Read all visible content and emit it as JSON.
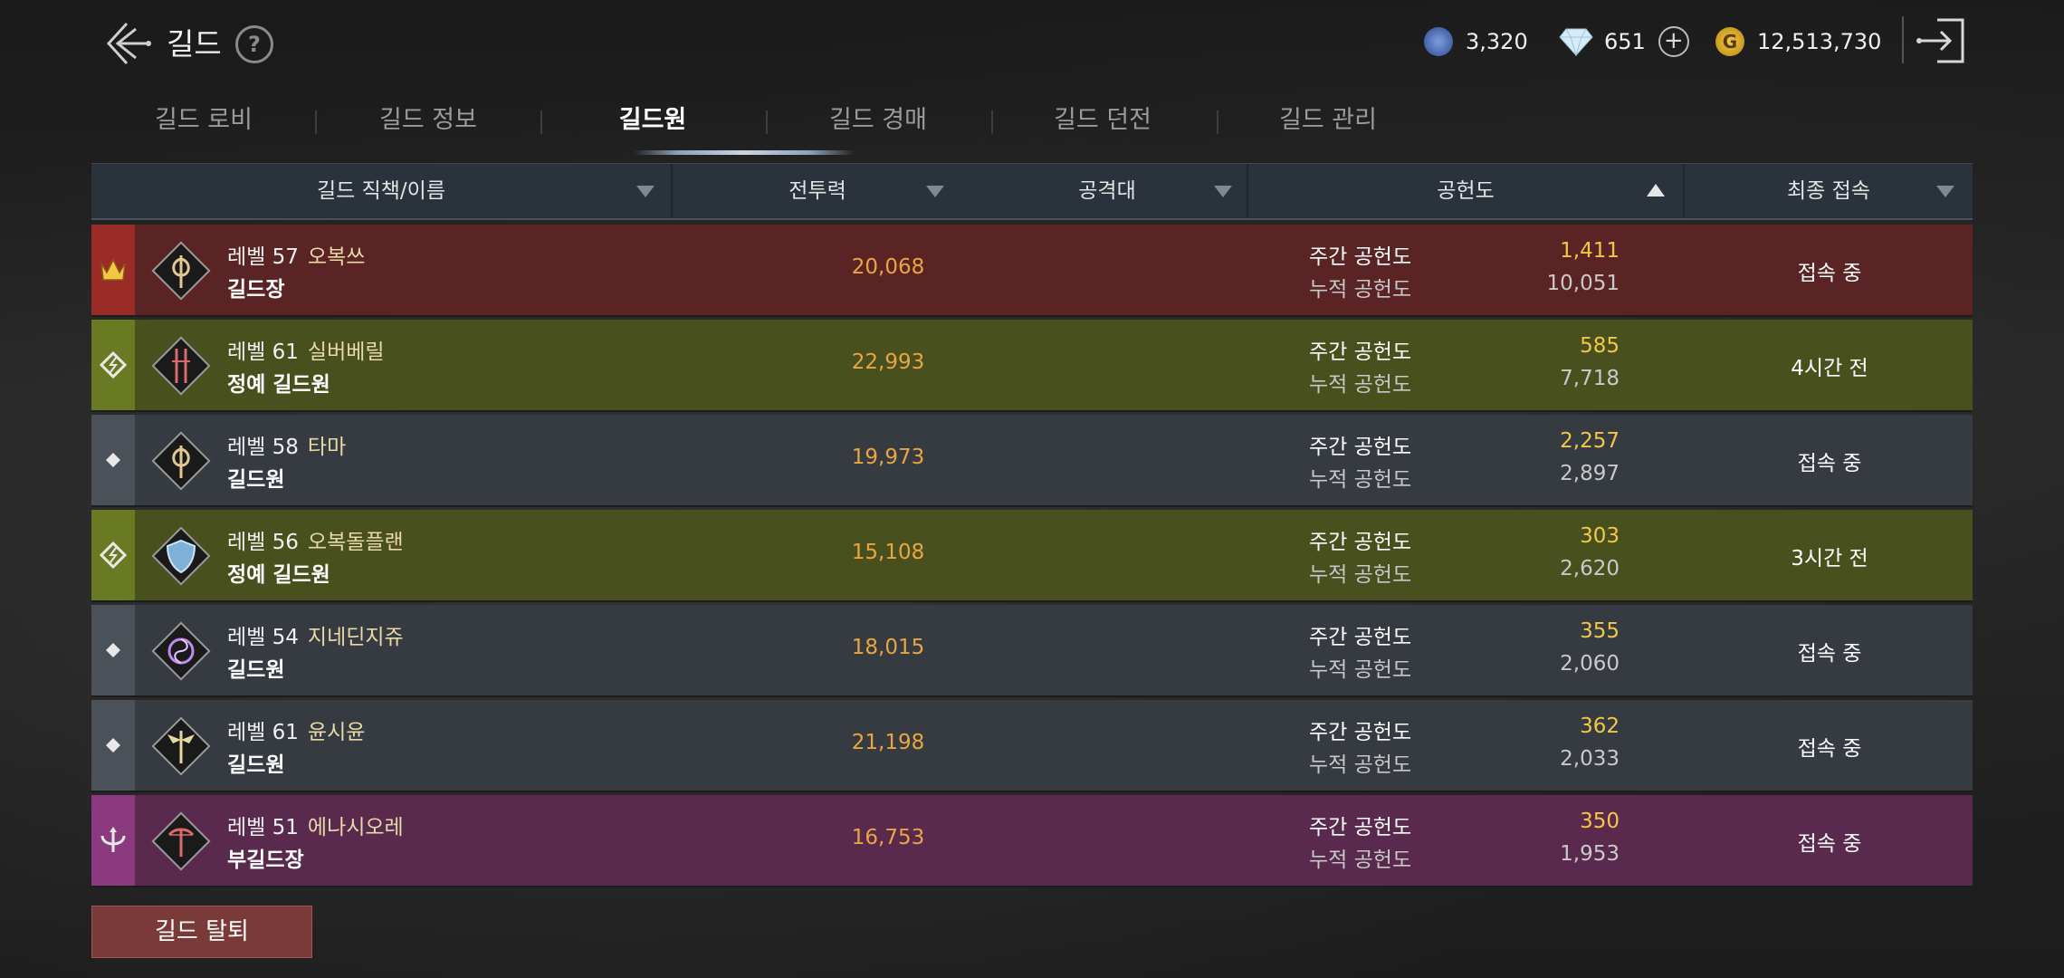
{
  "header": {
    "title": "길드",
    "help": "?",
    "currencies": [
      {
        "icon": "blue-crystal-icon",
        "value": "3,320",
        "color": "#3b5a9a"
      },
      {
        "icon": "diamond-icon",
        "value": "651",
        "add": "+",
        "color": "#cfe4f4"
      },
      {
        "icon": "gold-coin-icon",
        "value": "12,513,730",
        "color": "#d9a21e"
      }
    ]
  },
  "tabs": [
    "길드 로비",
    "길드 정보",
    "길드원",
    "길드 경매",
    "길드 던전",
    "길드 관리"
  ],
  "active_tab": 2,
  "columns": [
    "길드 직책/이름",
    "전투력",
    "공격대",
    "공헌도",
    "최종 접속"
  ],
  "members": [
    {
      "rank": "guild-master",
      "level": "레벨 57",
      "name": "오복쓰",
      "role": "길드장",
      "power": "20,068",
      "weekly_label": "주간 공헌도",
      "weekly": "1,411",
      "total_label": "누적 공헌도",
      "total": "10,051",
      "last": "접속 중",
      "row_color": "#5a2424",
      "rank_color": "#9b2b27",
      "class_icon": "axe-icon"
    },
    {
      "rank": "elite",
      "level": "레벨 61",
      "name": "실버베릴",
      "role": "정예 길드원",
      "power": "22,993",
      "weekly_label": "주간 공헌도",
      "weekly": "585",
      "total_label": "누적 공헌도",
      "total": "7,718",
      "last": "4시간 전",
      "row_color": "#48501e",
      "rank_color": "#6a7a22",
      "class_icon": "twin-blade-icon"
    },
    {
      "rank": "member",
      "level": "레벨 58",
      "name": "타마",
      "role": "길드원",
      "power": "19,973",
      "weekly_label": "주간 공헌도",
      "weekly": "2,257",
      "total_label": "누적 공헌도",
      "total": "2,897",
      "last": "접속 중",
      "row_color": "#363b42",
      "rank_color": "#4b5159",
      "class_icon": "axe-icon"
    },
    {
      "rank": "elite",
      "level": "레벨 56",
      "name": "오복돌플랜",
      "role": "정예 길드원",
      "power": "15,108",
      "weekly_label": "주간 공헌도",
      "weekly": "303",
      "total_label": "누적 공헌도",
      "total": "2,620",
      "last": "3시간 전",
      "row_color": "#48501e",
      "rank_color": "#6a7a22",
      "class_icon": "shield-icon"
    },
    {
      "rank": "member",
      "level": "레벨 54",
      "name": "지네딘지쥬",
      "role": "길드원",
      "power": "18,015",
      "weekly_label": "주간 공헌도",
      "weekly": "355",
      "total_label": "누적 공헌도",
      "total": "2,060",
      "last": "접속 중",
      "row_color": "#363b42",
      "rank_color": "#4b5159",
      "class_icon": "vortex-icon"
    },
    {
      "rank": "member",
      "level": "레벨 61",
      "name": "윤시윤",
      "role": "길드원",
      "power": "21,198",
      "weekly_label": "주간 공헌도",
      "weekly": "362",
      "total_label": "누적 공헌도",
      "total": "2,033",
      "last": "접속 중",
      "row_color": "#363b42",
      "rank_color": "#4b5159",
      "class_icon": "winged-staff-icon"
    },
    {
      "rank": "vice-master",
      "level": "레벨 51",
      "name": "에나시오레",
      "role": "부길드장",
      "power": "16,753",
      "weekly_label": "주간 공헌도",
      "weekly": "350",
      "total_label": "누적 공헌도",
      "total": "1,953",
      "last": "접속 중",
      "row_color": "#5a2a4e",
      "rank_color": "#8c3a80",
      "class_icon": "bow-icon"
    }
  ],
  "leave_button": "길드 탈퇴"
}
